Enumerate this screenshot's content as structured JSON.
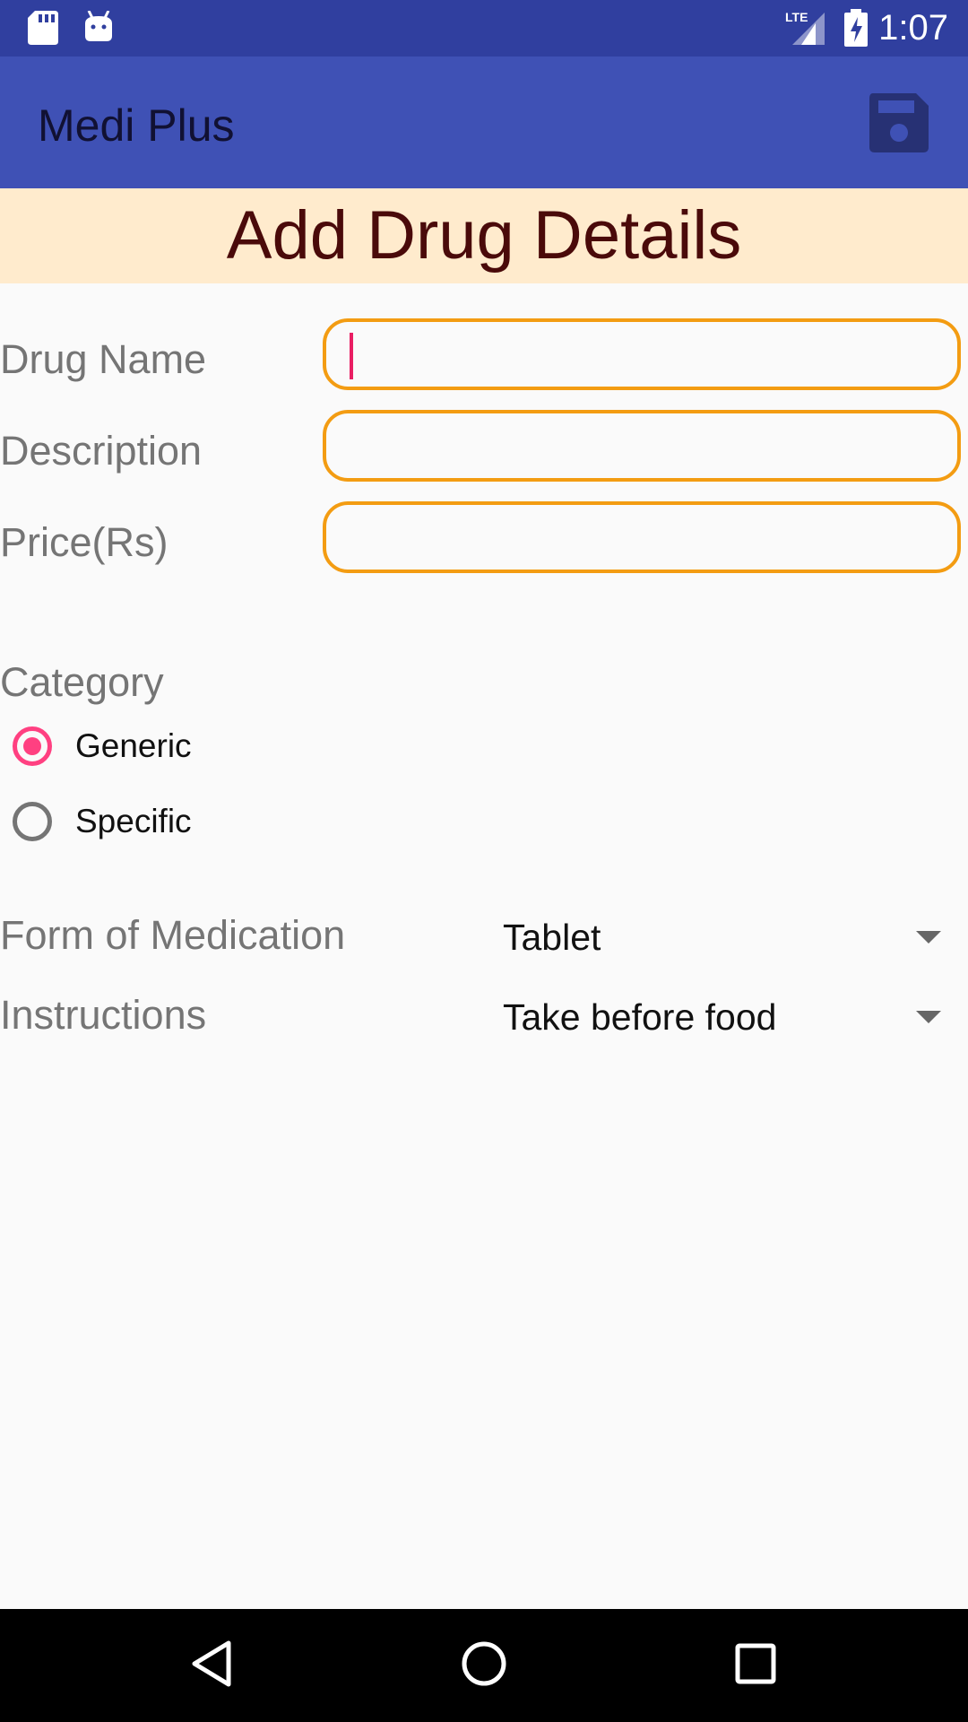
{
  "status_bar": {
    "time": "1:07",
    "icons": [
      "sd-card-icon",
      "android-debug-icon",
      "lte-signal-icon",
      "battery-charging-icon"
    ]
  },
  "app_bar": {
    "title": "Medi Plus",
    "save_icon": "save-icon"
  },
  "header": {
    "title": "Add Drug Details"
  },
  "form": {
    "drug_name_label": "Drug Name",
    "drug_name_value": "",
    "description_label": "Description",
    "description_value": "",
    "price_label": "Price(Rs)",
    "price_value": ""
  },
  "category": {
    "label": "Category",
    "options": [
      {
        "label": "Generic",
        "selected": true
      },
      {
        "label": "Specific",
        "selected": false
      }
    ]
  },
  "medication": {
    "form_label": "Form of Medication",
    "form_value": "Tablet",
    "instructions_label": "Instructions",
    "instructions_value": "Take before food"
  },
  "colors": {
    "status_bar": "#303f9f",
    "app_bar": "#3f51b5",
    "banner": "#ffebcd",
    "banner_text": "#4a0a0a",
    "field_border": "#f39c12",
    "accent": "#ff4081"
  },
  "nav_bar": {
    "icons": [
      "back-icon",
      "home-icon",
      "recents-icon"
    ]
  }
}
